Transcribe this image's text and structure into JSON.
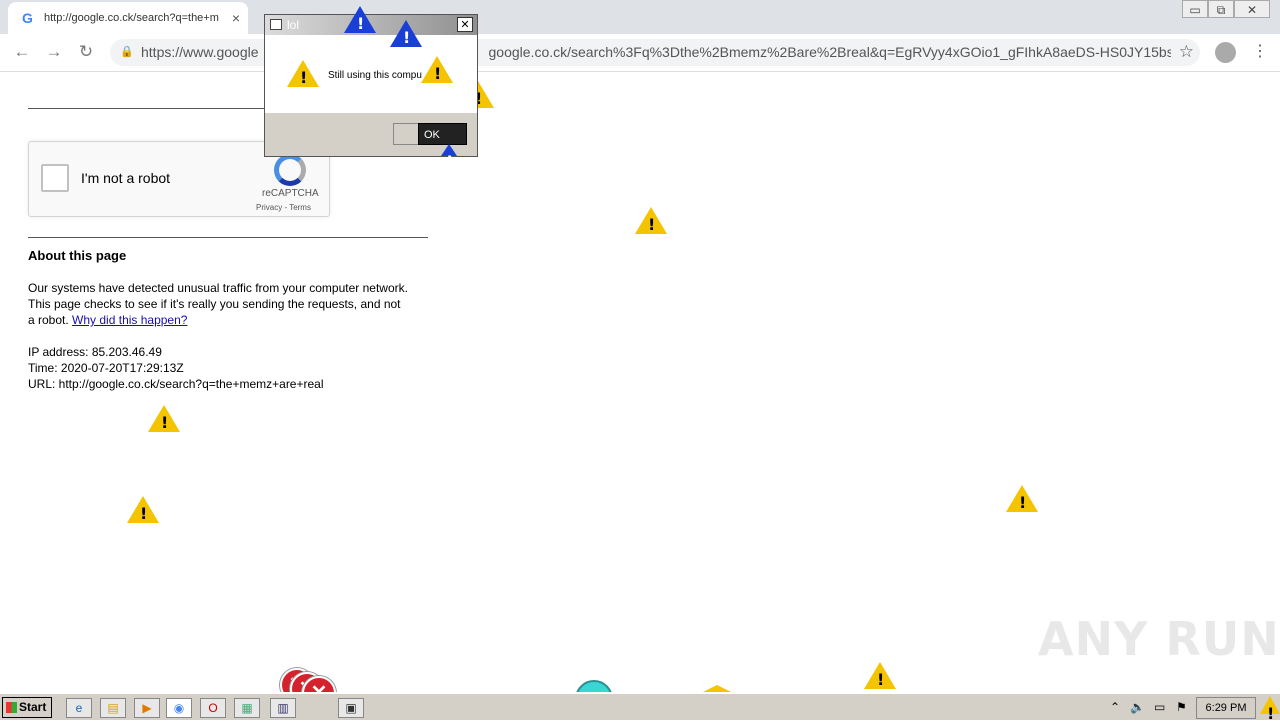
{
  "browser": {
    "tab_title": "http://google.co.ck/search?q=the+m",
    "tab_favicon": "G",
    "tab_close": "×",
    "url_prefix": "https://www.google",
    "url_suffix": "google.co.ck/search%3Fq%3Dthe%2Bmemz%2Bare%2Breal&q=EgRVyy4xGOio1_gFIhkA8aeDS-HS0JY15bs...",
    "window_controls": [
      "▭",
      "⧉",
      "✕"
    ]
  },
  "recaptcha": {
    "label": "I'm not a robot",
    "brand": "reCAPTCHA",
    "links": "Privacy - Terms"
  },
  "page": {
    "about_title": "About this page",
    "para_text": "Our systems have detected unusual traffic from your computer network. This page checks to see if it's really you sending the requests, and not a robot.",
    "para_link": "Why did this happen?",
    "ip_line": "IP address: 85.203.46.49",
    "time_line": "Time: 2020-07-20T17:29:13Z",
    "url_line": "URL: http://google.co.ck/search?q=the+memz+are+real"
  },
  "dialog": {
    "title": "lol",
    "message": "Still using this compu",
    "ok_label": "OK",
    "close_label": "✕"
  },
  "watermark": "ANY RUN",
  "taskbar": {
    "start_label": "Start",
    "clock": "6:29 PM"
  },
  "colors": {
    "warning_yellow": "#f5c400",
    "warning_blue": "#1a3fd6",
    "error_red": "#d4232d",
    "link_blue": "#1a0dab"
  }
}
